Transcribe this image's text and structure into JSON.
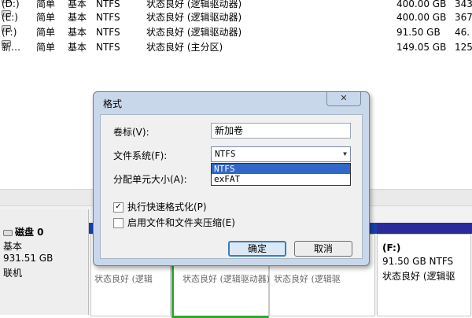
{
  "volume_list": {
    "rows": [
      {
        "name": "(D:)",
        "layout": "简单",
        "type": "基本",
        "fs": "NTFS",
        "status": "状态良好 (逻辑驱动器)",
        "capacity": "400.00 GB",
        "free": "343"
      },
      {
        "name": "(E:)",
        "layout": "简单",
        "type": "基本",
        "fs": "NTFS",
        "status": "状态良好 (逻辑驱动器)",
        "capacity": "400.00 GB",
        "free": "367"
      },
      {
        "name": "(F:)",
        "layout": "简单",
        "type": "基本",
        "fs": "NTFS",
        "status": "状态良好 (逻辑驱动器)",
        "capacity": "91.50 GB",
        "free": "46."
      },
      {
        "name": "新…",
        "layout": "简单",
        "type": "基本",
        "fs": "NTFS",
        "status": "状态良好 (主分区)",
        "capacity": "149.05 GB",
        "free": "125"
      }
    ]
  },
  "disk": {
    "name": "磁盘 0",
    "type": "基本",
    "size": "931.51 GB",
    "state": "联机"
  },
  "partitions": {
    "status_fragments": [
      "状态良好 (逻辑",
      "状态良好 (逻辑驱动器)",
      "状态良好 (逻辑驱"
    ],
    "f": {
      "title": "(F:)",
      "size_fs": "91.50 GB NTFS",
      "status": "状态良好 (逻辑驱"
    }
  },
  "dialog": {
    "title": "格式",
    "close_symbol": "✕",
    "volume_label_caption": "卷标(V):",
    "volume_label_value": "新加卷",
    "fs_caption": "文件系统(F):",
    "fs_selected": "NTFS",
    "fs_options": [
      "NTFS",
      "exFAT"
    ],
    "alloc_caption": "分配单元大小(A):",
    "quick_format_label": "执行快速格式化(P)",
    "quick_format_checked": true,
    "compression_label": "启用文件和文件夹压缩(E)",
    "compression_checked": false,
    "ok_label": "确定",
    "cancel_label": "取消"
  },
  "colors": {
    "disk_bar": "#1a3fa8",
    "selection": "#3167c6",
    "partition_border": "#32a832"
  }
}
